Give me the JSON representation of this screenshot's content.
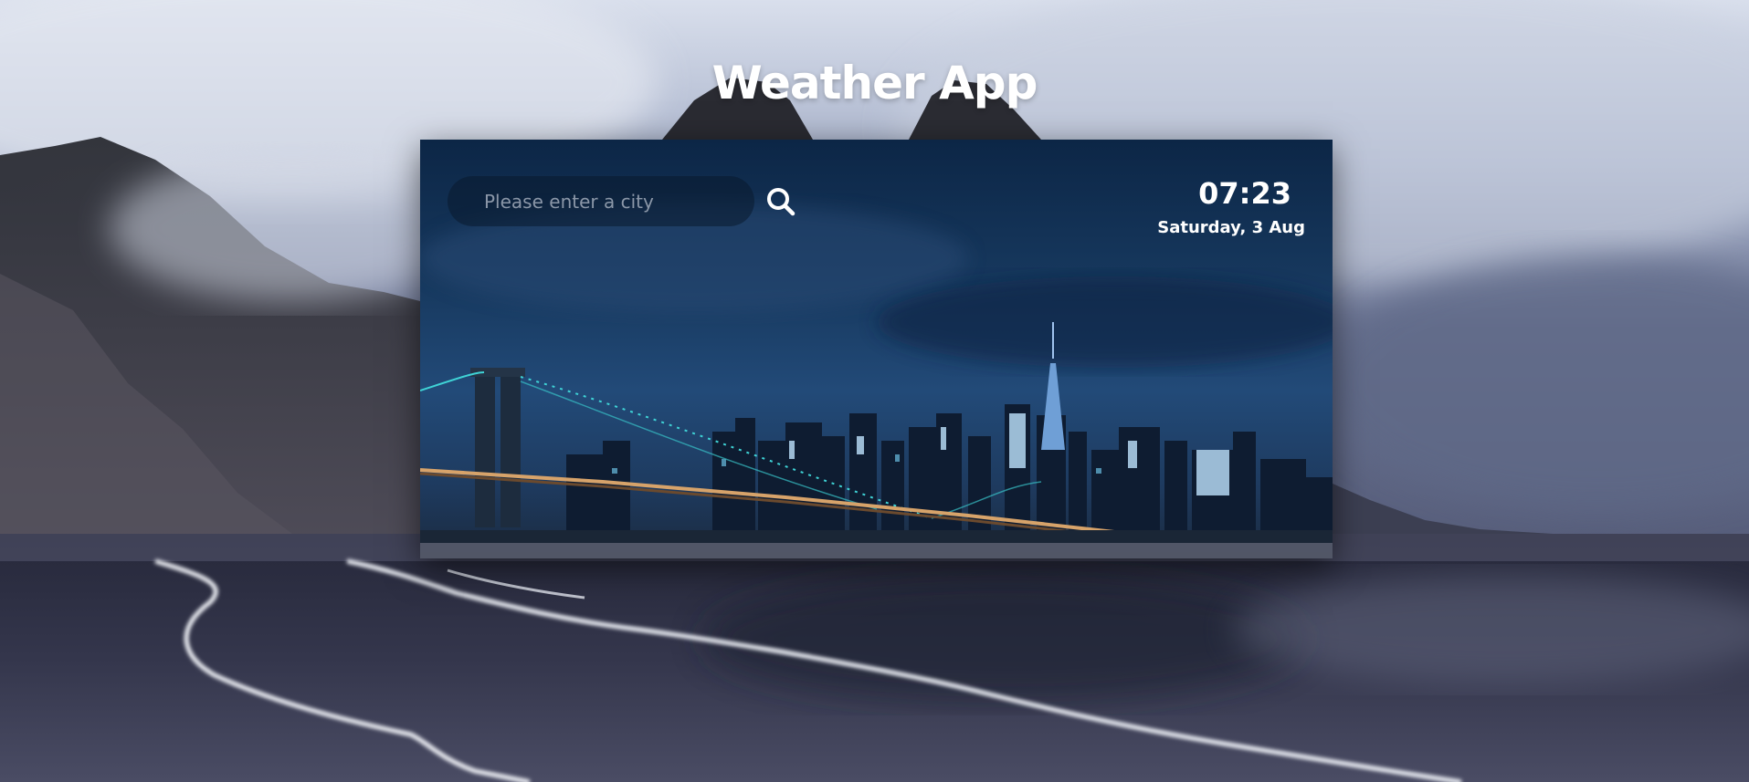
{
  "app": {
    "title": "Weather App"
  },
  "search": {
    "placeholder": "Please enter a city",
    "value": "",
    "icon": "search-icon"
  },
  "clock": {
    "time": "07:23",
    "date": "Saturday, 3 Aug"
  },
  "colors": {
    "title_text": "#ffffff",
    "search_bg": "#0a192d",
    "placeholder_text": "#8b97a8",
    "card_sky": "#163a63"
  }
}
